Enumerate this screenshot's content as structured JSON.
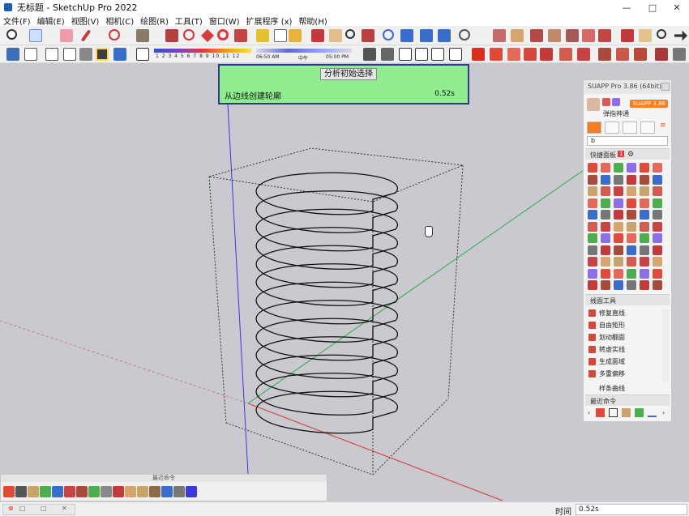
{
  "window": {
    "title": "无标题 - SketchUp Pro 2022",
    "minimize": "—",
    "maximize": "□",
    "close": "✕"
  },
  "menu": [
    "文件(F)",
    "编辑(E)",
    "视图(V)",
    "相机(C)",
    "绘图(R)",
    "工具(T)",
    "窗口(W)",
    "扩展程序 (x)",
    "帮助(H)"
  ],
  "shadow_settings": {
    "months": "1 2 3 4 5 6 7 8 9 10 11 12",
    "time_start": "06:50 AM",
    "time_noon": "中午",
    "time_end": "05:00 PM"
  },
  "hint": {
    "button": "分析初始选择",
    "message": "从边线创建轮廓",
    "elapsed": "0.52s"
  },
  "suapp": {
    "title": "SUAPP Pro 3.86 (64bit)",
    "user": "弹指神通",
    "version_badge": "SUAPP 3.86",
    "search_value": "b",
    "quick_panel": "快捷面板",
    "quick_count": "1",
    "draw_tools_header": "线面工具",
    "tools": [
      "修复直线",
      "自由矩形",
      "划动翻面",
      "转虚实线",
      "生成面域",
      "多重偏移",
      "样条曲线"
    ],
    "recent_header": "最近命令"
  },
  "recent_bar": {
    "title": "最近命令"
  },
  "status": {
    "label": "时间",
    "value": "0.52s"
  },
  "icons": {
    "app": "sketchup-icon",
    "cursor": "hand-cursor-icon"
  }
}
